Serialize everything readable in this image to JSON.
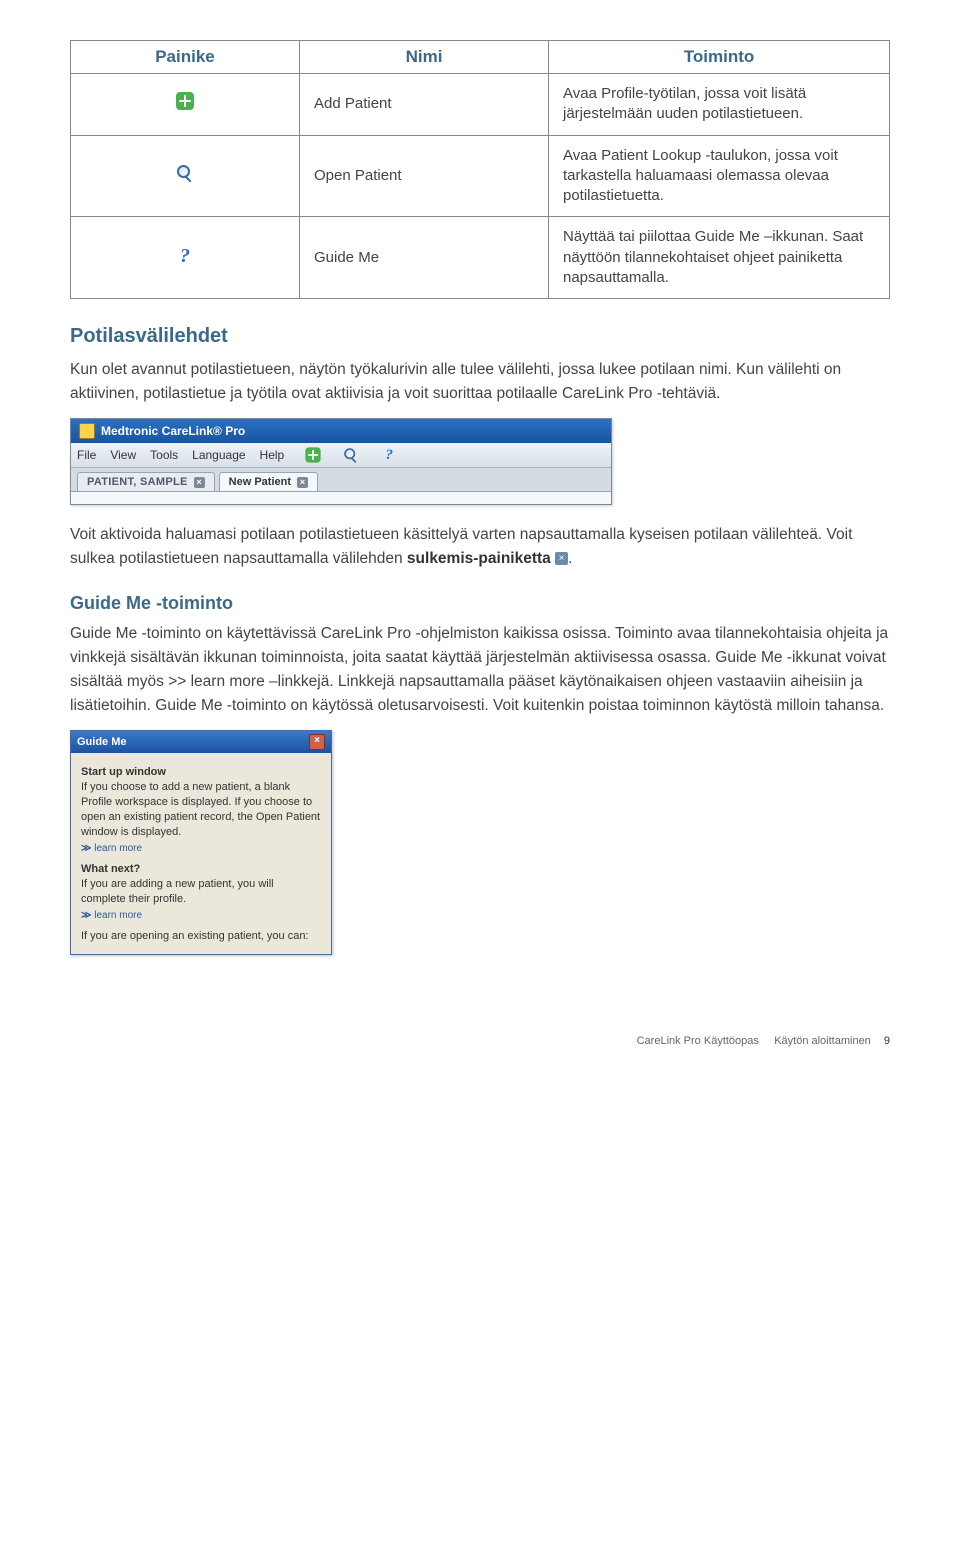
{
  "table": {
    "headers": [
      "Painike",
      "Nimi",
      "Toiminto"
    ],
    "rows": [
      {
        "icon": "add-icon",
        "name": "Add Patient",
        "desc": "Avaa Profile-työtilan, jossa voit lisätä järjestelmään uuden potilastietueen."
      },
      {
        "icon": "open-icon",
        "name": "Open Patient",
        "desc": "Avaa Patient Lookup -taulukon, jossa voit tarkastella haluamaasi olemassa olevaa potilastietuetta."
      },
      {
        "icon": "guide-icon",
        "name": "Guide Me",
        "desc": "Näyttää tai piilottaa Guide Me –ikkunan. Saat näyttöön tilannekohtaiset ohjeet painiketta napsauttamalla."
      }
    ]
  },
  "sections": {
    "potilas_title": "Potilasvälilehdet",
    "potilas_para": "Kun olet avannut potilastietueen, näytön työkalurivin alle tulee välilehti, jossa lukee potilaan nimi. Kun välilehti on aktiivinen, potilastietue ja työtila ovat aktiivisia ja voit suorittaa potilaalle CareLink Pro -tehtäviä.",
    "activation_p1a": "Voit aktivoida haluamasi potilaan potilastietueen käsittelyä varten napsauttamalla kyseisen potilaan välilehteä. Voit sulkea potilastietueen napsauttamalla välilehden ",
    "activation_p1b_bold": "sulkemis-painiketta",
    "activation_p1c": " ",
    "activation_p1d": ".",
    "guide_title": "Guide Me -toiminto",
    "guide_para": "Guide Me -toiminto on käytettävissä CareLink Pro -ohjelmiston kaikissa osissa. Toiminto avaa tilannekohtaisia ohjeita ja vinkkejä sisältävän ikkunan toiminnoista, joita saatat käyttää järjestelmän aktiivisessa osassa. Guide Me -ikkunat voivat sisältää myös >> learn more –linkkejä. Linkkejä napsauttamalla pääset käytönaikaisen ohjeen vastaaviin aiheisiin ja lisätietoihin. Guide Me -toiminto on käytössä oletusarvoisesti. Voit kuitenkin poistaa toiminnon käytöstä milloin tahansa.",
    "learn_more_bold": "learn more"
  },
  "app_screenshot": {
    "title": "Medtronic CareLink® Pro",
    "menu": [
      "File",
      "View",
      "Tools",
      "Language",
      "Help"
    ],
    "tabs": [
      {
        "label": "PATIENT, SAMPLE",
        "active": false
      },
      {
        "label": "New Patient",
        "active": true
      }
    ]
  },
  "guide_window": {
    "title": "Guide Me",
    "section1_title": "Start up window",
    "section1_body": "If you choose to add a new patient, a blank Profile workspace is displayed. If you choose to open an existing patient record, the Open Patient window is displayed.",
    "learn_more": "learn more",
    "section2_title": "What next?",
    "section2_body1": "If you are adding a new patient, you will complete their profile.",
    "section2_body2": "If you are opening an existing patient, you can:"
  },
  "footer": {
    "left": "CareLink Pro Käyttöopas",
    "right": "Käytön aloittaminen",
    "page": "9"
  }
}
